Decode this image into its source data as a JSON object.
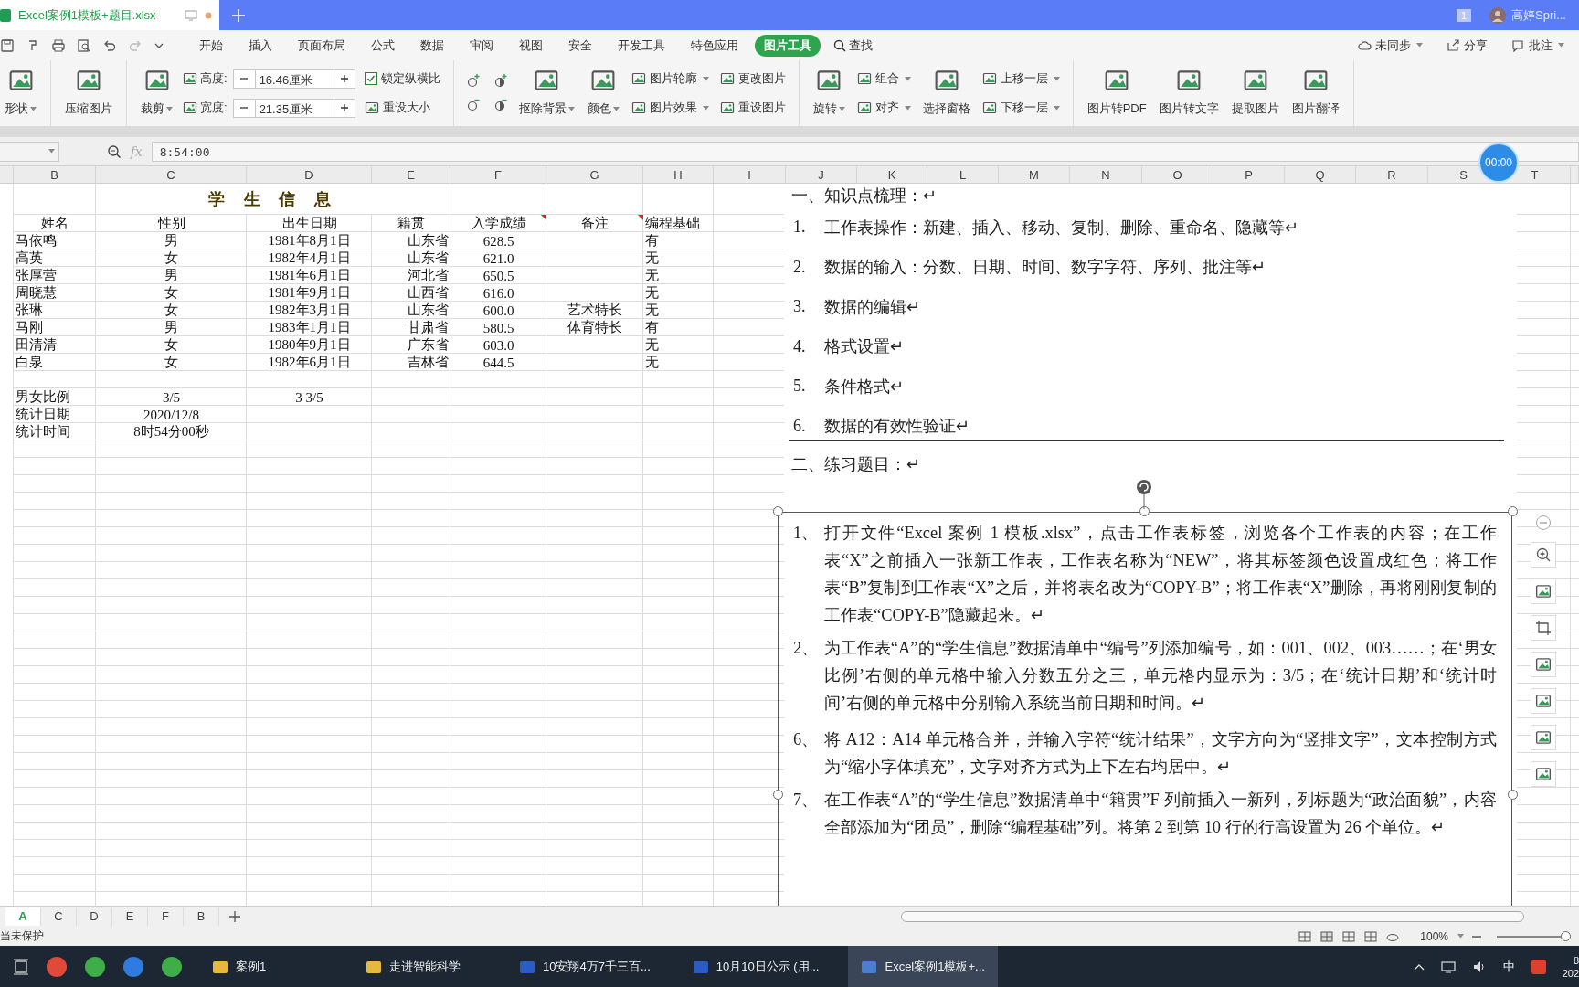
{
  "title_bar": {
    "tab": "Excel案例1模板+题目.xlsx",
    "badge": "1",
    "user": "高婷Spri..."
  },
  "menu": [
    {
      "label": "开始",
      "selected": false
    },
    {
      "label": "插入",
      "selected": false
    },
    {
      "label": "页面布局",
      "selected": false
    },
    {
      "label": "公式",
      "selected": false
    },
    {
      "label": "数据",
      "selected": false
    },
    {
      "label": "审阅",
      "selected": false
    },
    {
      "label": "视图",
      "selected": false
    },
    {
      "label": "安全",
      "selected": false
    },
    {
      "label": "开发工具",
      "selected": false
    },
    {
      "label": "特色应用",
      "selected": false
    },
    {
      "label": "图片工具",
      "selected": true
    }
  ],
  "search": "查找",
  "menu_right": [
    "未同步",
    "分享",
    "批注"
  ],
  "ribbon_groups": [
    [
      {
        "kind": "big",
        "label": "形状",
        "caret": true
      }
    ],
    [
      {
        "kind": "big",
        "label": "压缩图片",
        "caret": false
      }
    ],
    [
      {
        "kind": "big",
        "label": "裁剪",
        "caret": true
      },
      {
        "kind": "size",
        "fields": [
          {
            "label": "高度:",
            "value": "16.46厘米"
          },
          {
            "label": "宽度:",
            "value": "21.35厘米"
          }
        ]
      },
      {
        "kind": "stack",
        "items": [
          {
            "kind": "check",
            "label": "锁定纵横比",
            "checked": true
          },
          {
            "kind": "button",
            "label": "重设大小",
            "caret": false
          }
        ]
      }
    ],
    [
      {
        "kind": "icons"
      },
      {
        "kind": "big",
        "label": "抠除背景",
        "caret": true
      },
      {
        "kind": "big",
        "label": "颜色",
        "caret": true
      },
      {
        "kind": "stack",
        "items": [
          {
            "kind": "button",
            "label": "图片轮廓",
            "caret": true
          },
          {
            "kind": "button",
            "label": "图片效果",
            "caret": true
          }
        ]
      },
      {
        "kind": "stack",
        "items": [
          {
            "kind": "button",
            "label": "更改图片",
            "caret": false
          },
          {
            "kind": "button",
            "label": "重设图片",
            "caret": false
          }
        ]
      }
    ],
    [
      {
        "kind": "big",
        "label": "旋转",
        "caret": true
      },
      {
        "kind": "stack",
        "items": [
          {
            "kind": "button",
            "label": "组合",
            "caret": true
          },
          {
            "kind": "button",
            "label": "对齐",
            "caret": true
          }
        ]
      },
      {
        "kind": "big",
        "label": "选择窗格",
        "caret": false
      },
      {
        "kind": "stack",
        "items": [
          {
            "kind": "button",
            "label": "上移一层",
            "caret": true
          },
          {
            "kind": "button",
            "label": "下移一层",
            "caret": true
          }
        ]
      }
    ],
    [
      {
        "kind": "big",
        "label": "图片转PDF",
        "caret": false
      },
      {
        "kind": "big",
        "label": "图片转文字",
        "caret": false
      },
      {
        "kind": "big",
        "label": "提取图片",
        "caret": false
      },
      {
        "kind": "big",
        "label": "图片翻译",
        "caret": false
      }
    ]
  ],
  "formula_bar": {
    "fx": "fx",
    "value": "8:54:00"
  },
  "timer": "00:00",
  "columns": [
    "B",
    "C",
    "D",
    "E",
    "F",
    "G",
    "H",
    "I",
    "J",
    "K",
    "L",
    "M",
    "N",
    "O",
    "P",
    "Q",
    "R",
    "S",
    "T"
  ],
  "sheet": {
    "title": "学 生 信 息",
    "headers": [
      {
        "text": "姓名",
        "comment": false
      },
      {
        "text": "性别",
        "comment": false
      },
      {
        "text": "出生日期",
        "comment": false
      },
      {
        "text": "籍贯",
        "comment": false
      },
      {
        "text": "入学成绩",
        "comment": true
      },
      {
        "text": "备注",
        "comment": true
      },
      {
        "text": "编程基础",
        "comment": false
      }
    ],
    "rows": [
      {
        "name": "马依鸣",
        "gender": "男",
        "birth": "1981年8月1日",
        "origin": "山东省",
        "score": "628.5",
        "coding": "有"
      },
      {
        "name": "高英",
        "gender": "女",
        "birth": "1982年4月1日",
        "origin": "山东省",
        "score": "621.0",
        "coding": "无"
      },
      {
        "name": "张厚营",
        "gender": "男",
        "birth": "1981年6月1日",
        "origin": "河北省",
        "score": "650.5",
        "coding": "无"
      },
      {
        "name": "周晓慧",
        "gender": "女",
        "birth": "1981年9月1日",
        "origin": "山西省",
        "score": "616.0",
        "coding": "无"
      },
      {
        "name": "张琳",
        "gender": "女",
        "birth": "1982年3月1日",
        "origin": "山东省",
        "score": "600.0",
        "note": "艺术特长",
        "coding": "无"
      },
      {
        "name": "马刚",
        "gender": "男",
        "birth": "1983年1月1日",
        "origin": "甘肃省",
        "score": "580.5",
        "note": "体育特长",
        "coding": "有"
      },
      {
        "name": "田清清",
        "gender": "女",
        "birth": "1980年9月1日",
        "origin": "广东省",
        "score": "603.0",
        "coding": "无"
      },
      {
        "name": "白泉",
        "gender": "女",
        "birth": "1982年6月1日",
        "origin": "吉林省",
        "score": "644.5",
        "coding": "无"
      }
    ],
    "summary": [
      {
        "label": "男女比例",
        "value": "3/5",
        "extra": "3 3/5"
      },
      {
        "label": "统计日期",
        "value": "2020/12/8"
      },
      {
        "label": "统计时间",
        "value": "8时54分00秒"
      }
    ]
  },
  "document": {
    "heading_1": "一、知识点梳理：↵",
    "points": [
      {
        "num": "1.",
        "text": "工作表操作：新建、插入、移动、复制、删除、重命名、隐藏等↵"
      },
      {
        "num": "2.",
        "text": "数据的输入：分数、日期、时间、数字字符、序列、批注等↵"
      },
      {
        "num": "3.",
        "text": "数据的编辑↵"
      },
      {
        "num": "4.",
        "text": "格式设置↵"
      },
      {
        "num": "5.",
        "text": "条件格式↵"
      },
      {
        "num": "6.",
        "text": "数据的有效性验证↵"
      }
    ],
    "heading_2": "二、练习题目：↵",
    "tasks": [
      {
        "num": "1、",
        "text": "打开文件“Excel 案例 1 模板.xlsx”，点击工作表标签，浏览各个工作表的内容；在工作表“X”之前插入一张新工作表，工作表名称为“NEW”，将其标签颜色设置成红色；将工作表“B”复制到工作表“X”之后，并将表名改为“COPY-B”；将工作表“X”删除，再将刚刚复制的工作表“COPY-B”隐藏起来。↵"
      },
      {
        "num": "2、",
        "text": "为工作表“A”的“学生信息”数据清单中“编号”列添加编号，如：001、002、003……；在‘男女比例’右侧的单元格中输入分数五分之三，单元格内显示为：3/5；在‘统计日期’和‘统计时间’右侧的单元格中分别输入系统当前日期和时间。↵"
      },
      {
        "num": "6、",
        "text": "将 A12：A14 单元格合并，并输入字符“统计结果”，文字方向为“竖排文字”，文本控制方式为“缩小字体填充”，文字对齐方式为上下左右均居中。↵"
      },
      {
        "num": "7、",
        "text": "在工作表“A”的“学生信息”数据清单中“籍贯”F 列前插入一新列，列标题为“政治面貌”，内容全部添加为“团员”，删除“编程基础”列。将第 2 到第 10 行的行高设置为 26 个单位。↵"
      }
    ]
  },
  "sheet_tabs": [
    {
      "label": "A",
      "selected": true
    },
    {
      "label": "C",
      "selected": false
    },
    {
      "label": "D",
      "selected": false
    },
    {
      "label": "E",
      "selected": false
    },
    {
      "label": "F",
      "selected": false
    },
    {
      "label": "B",
      "selected": false
    }
  ],
  "status_bar": {
    "protection": "当未保护",
    "zoom": "100%",
    "zoom_slider": {
      "level": 0.95
    }
  },
  "taskbar": {
    "items": [
      {
        "label": "案例1",
        "active": false
      },
      {
        "label": "走进智能科学",
        "active": false
      },
      {
        "label": "10安翔4万7千三百...",
        "active": false
      },
      {
        "label": "10月10日公示 (用...",
        "active": false
      },
      {
        "label": "Excel案例1模板+...",
        "active": true
      }
    ],
    "ime": "中",
    "clock": {
      "time": "8",
      "date": "202"
    }
  }
}
